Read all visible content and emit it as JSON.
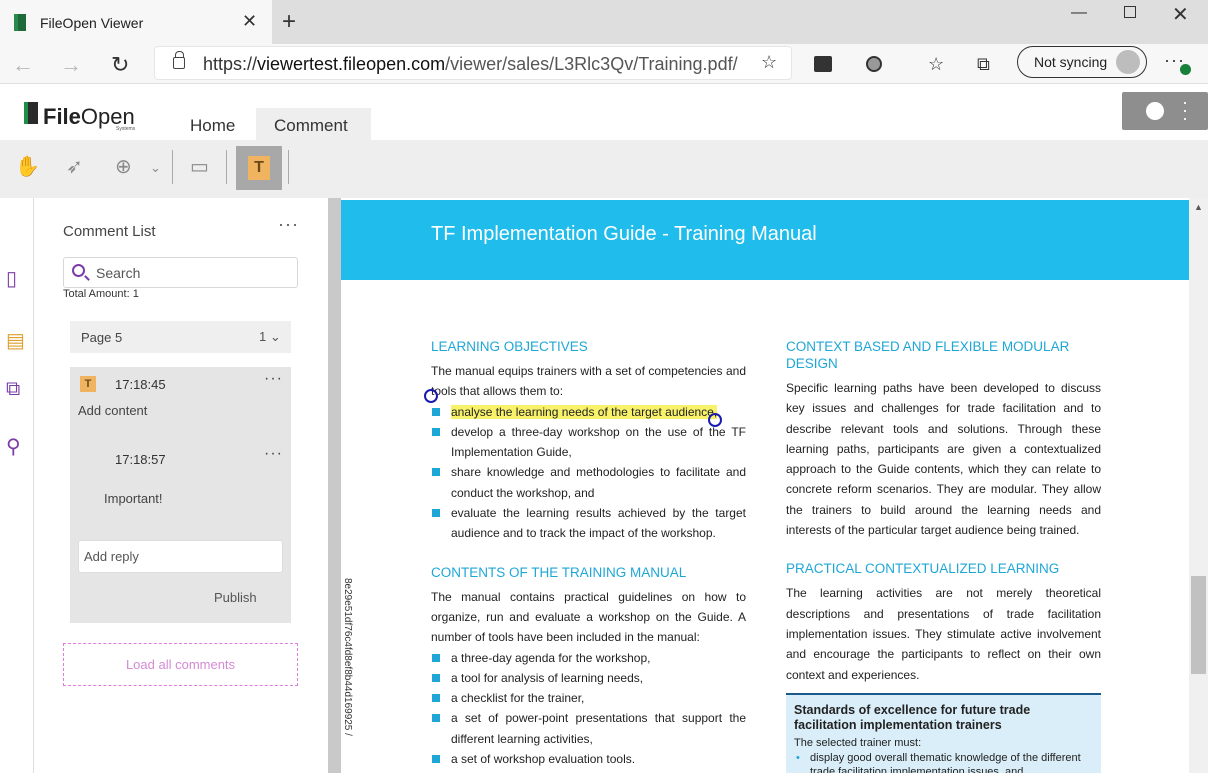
{
  "browser": {
    "tab_title": "FileOpen Viewer",
    "tab_close": "✕",
    "new_tab": "+",
    "url_host_prefix": "https://",
    "url_host": "viewertest.fileopen.com",
    "url_path": "/viewer/sales/L3Rlc3Qv/Training.pdf/",
    "sync_label": "Not syncing"
  },
  "app": {
    "logo_bold": "File",
    "logo_light": "Open",
    "logo_sub": "Systems",
    "tabs": {
      "home": "Home",
      "comment": "Comment"
    },
    "text_tool_label": "T"
  },
  "comments": {
    "title": "Comment List",
    "search_placeholder": "Search",
    "total_amount": "Total Amount:  1",
    "page_group": {
      "label": "Page 5",
      "count": "1"
    },
    "card": {
      "icon_letter": "T",
      "time1": "17:18:45",
      "content": "Add content",
      "time2": "17:18:57",
      "reply_text": "Important!",
      "reply_placeholder": "Add reply",
      "publish": "Publish"
    },
    "load_all": "Load all comments"
  },
  "document": {
    "side_id": "8e29e51df76c4fd8ef8b44d169925 / ",
    "title": "TF Implementation Guide - Training Manual",
    "left": {
      "sec1_heading": "LEARNING OBJECTIVES",
      "sec1_intro": "The manual equips trainers with a set of competencies and tools that allows them to:",
      "sec1_bullets": [
        "analyse the learning needs of the target audience,",
        "develop a three-day workshop on the use of the TF Implementation Guide,",
        "share knowledge and methodologies to facilitate and conduct the workshop, and",
        "evaluate the learning results achieved by the target audience and to track the impact of the workshop."
      ],
      "sec2_heading": "CONTENTS OF THE TRAINING MANUAL",
      "sec2_intro": "The manual contains practical guidelines on how to organize, run and evaluate a workshop on the Guide.  A number of tools have been included in the manual:",
      "sec2_bullets": [
        "a three-day agenda for the workshop,",
        "a tool for analysis of learning needs,",
        "a checklist for the trainer,",
        "a set of power-point presentations that support the different learning activities,",
        "a set of workshop evaluation tools."
      ]
    },
    "right": {
      "sec1_heading": "CONTEXT BASED AND FLEXIBLE MODULAR DESIGN",
      "sec1_text": "Specific learning paths have been developed to discuss key issues and challenges for trade facilitation and to describe relevant tools and solutions. Through these learning paths, participants are given a contextualized approach to the Guide contents, which they can relate to concrete reform scenarios. They are modular. They allow the trainers to build around the learning needs and interests of the particular target audience being trained.",
      "sec2_heading": "PRACTICAL CONTEXTUALIZED LEARNING",
      "sec2_text": "The learning activities are not merely theoretical descriptions and presentations of trade facilitation implementation issues. They stimulate active involvement and encourage the participants to reflect on their own context and experiences.",
      "box_title": "Standards of excellence for future trade facilitation implementation trainers",
      "box_sub": "The selected trainer must:",
      "box_bullets": [
        "display good overall thematic knowledge of the different trade facilitation implementation issues, and"
      ]
    }
  },
  "colors": {
    "banner": "#1fbcec",
    "heading": "#1ea7d6",
    "highlight": "#f7f26a",
    "accent_purple": "#7b3ca8",
    "text_tool": "#f0b460"
  }
}
